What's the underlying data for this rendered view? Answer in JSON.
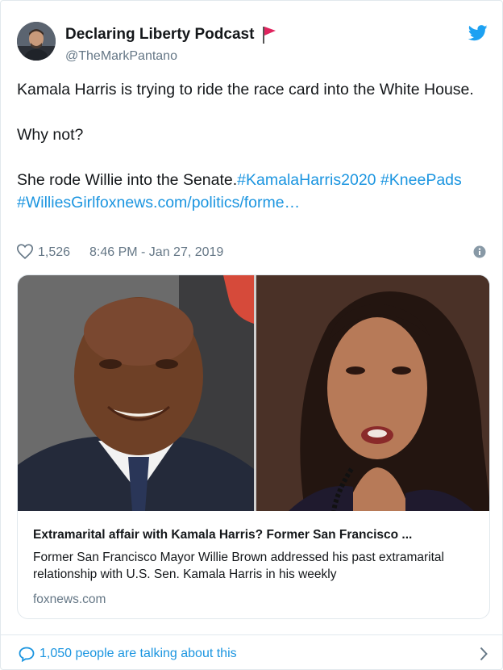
{
  "tweet": {
    "display_name": "Declaring Liberty Podcast",
    "handle": "@TheMarkPantano",
    "text": {
      "line1": "Kamala Harris is trying to ride the race card into the White House.",
      "line2": "Why not?",
      "line3_plain": "She rode Willie into the Senate.",
      "hashtag1": "#KamalaHarris2020",
      "hashtag2": "#KneePads",
      "hashtag3": "#WilliesGirl",
      "url": "foxnews.com/politics/forme…"
    },
    "likes": "1,526",
    "timestamp": "8:46 PM - Jan 27, 2019"
  },
  "link_card": {
    "title": "Extramarital affair with Kamala Harris? Former San Francisco ...",
    "description": "Former San Francisco Mayor Willie Brown addressed his past extramarital relationship with U.S. Sen. Kamala Harris in his weekly",
    "domain": "foxnews.com"
  },
  "footer": {
    "talking": "1,050 people are talking about this"
  },
  "icons": {
    "flag": "red-flag-icon",
    "brand": "twitter-bird-icon",
    "like": "heart-icon",
    "info": "info-icon",
    "reply": "speech-bubble-icon",
    "more": "chevron-right-icon"
  },
  "colors": {
    "link": "#1b95e0",
    "twitter_blue": "#1da1f2",
    "muted": "#657786",
    "flag": "#e0245e"
  }
}
